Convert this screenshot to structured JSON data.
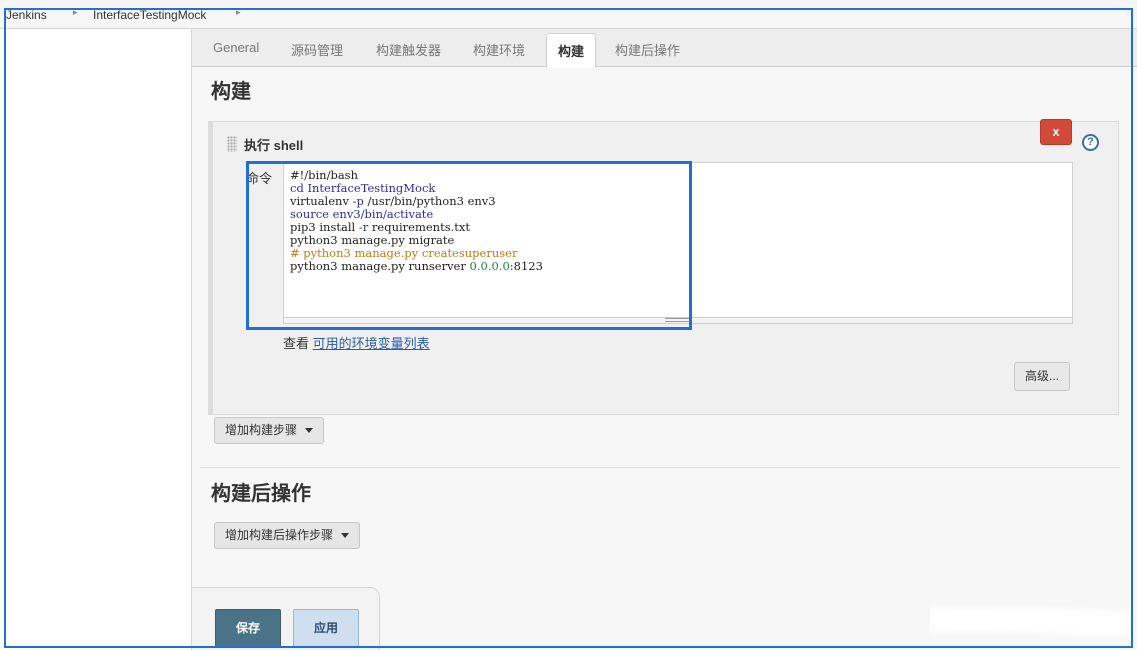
{
  "breadcrumb": {
    "items": [
      "Jenkins",
      "InterfaceTestingMock"
    ]
  },
  "tabs": [
    {
      "label": "General"
    },
    {
      "label": "源码管理"
    },
    {
      "label": "构建触发器"
    },
    {
      "label": "构建环境"
    },
    {
      "label": "构建",
      "active": true
    },
    {
      "label": "构建后操作"
    }
  ],
  "build_section": {
    "title": "构建",
    "step": {
      "title": "执行 shell",
      "delete_label": "x",
      "help_label": "?",
      "command_label": "命令",
      "command_lines": [
        "#!/bin/bash",
        "cd InterfaceTestingMock",
        "virtualenv -p /usr/bin/python3 env3",
        "source env3/bin/activate",
        "pip3 install -r requirements.txt",
        "python3 manage.py migrate",
        "# python3 manage.py createsuperuser",
        "python3 manage.py runserver 0.0.0.0:8123"
      ],
      "env_prefix": "查看",
      "env_link": "可用的环境变量列表",
      "advanced_label": "高级..."
    },
    "add_step_label": "增加构建步骤"
  },
  "post_build_section": {
    "title": "构建后操作",
    "add_step_label": "增加构建后操作步骤"
  },
  "footer": {
    "save_label": "保存",
    "apply_label": "应用"
  },
  "colors": {
    "highlight": "#1f6fd6",
    "delete": "#d24939",
    "save": "#4a7388",
    "apply": "#cfdfef",
    "link": "#2a5db0"
  }
}
